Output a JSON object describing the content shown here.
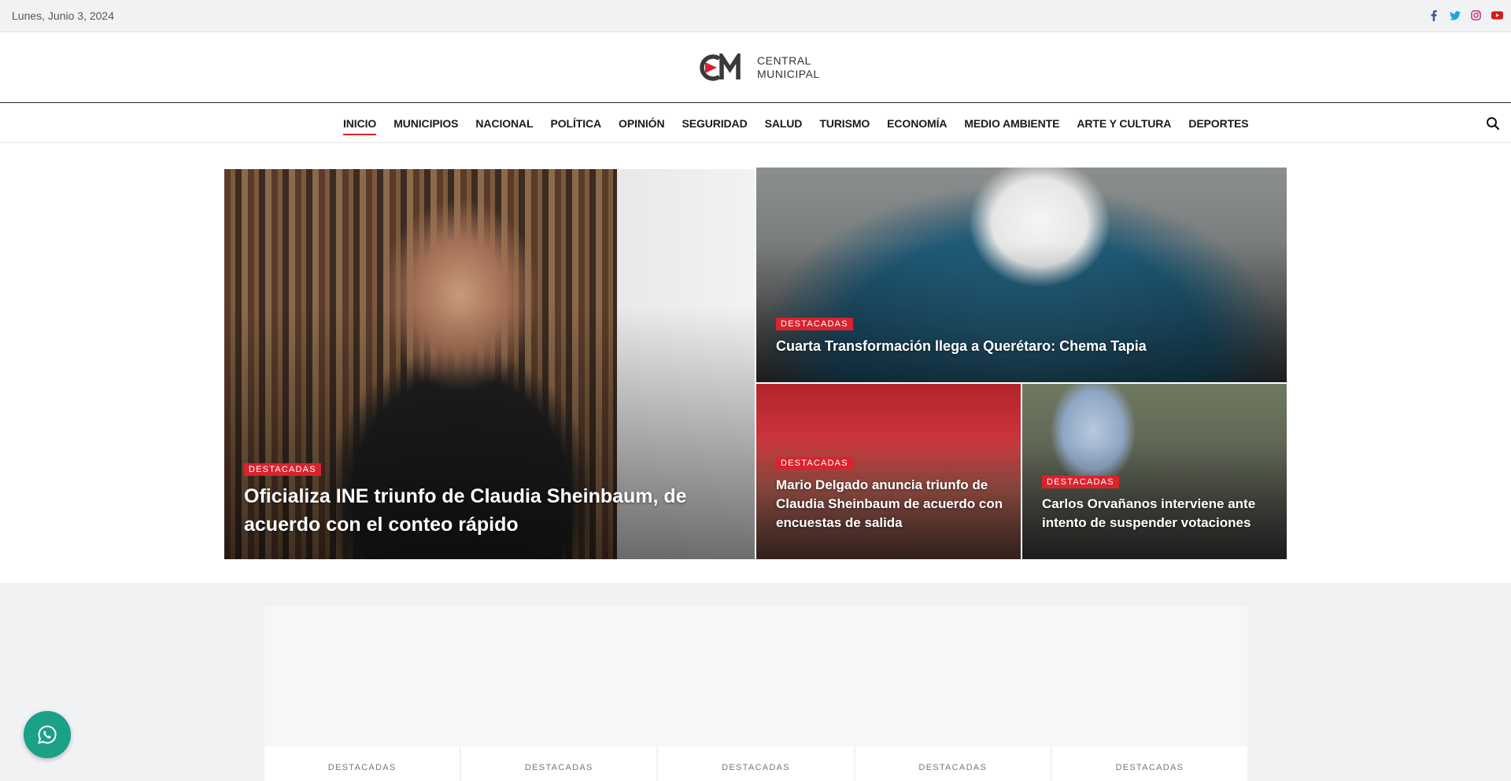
{
  "topbar": {
    "date": "Lunes, Junio 3, 2024",
    "socials": [
      {
        "icon": "facebook-icon",
        "color": "#3b5998"
      },
      {
        "icon": "twitter-icon",
        "color": "#1da1f2"
      },
      {
        "icon": "instagram-icon",
        "color": "#c13584"
      },
      {
        "icon": "youtube-icon",
        "color": "#d61a1a"
      }
    ]
  },
  "logo": {
    "line1": "CENTRAL",
    "line2": "MUNICIPAL"
  },
  "nav": {
    "items": [
      {
        "label": "INICIO",
        "active": true
      },
      {
        "label": "MUNICIPIOS"
      },
      {
        "label": "NACIONAL"
      },
      {
        "label": "POLÍTICA"
      },
      {
        "label": "OPINIÓN"
      },
      {
        "label": "SEGURIDAD"
      },
      {
        "label": "SALUD"
      },
      {
        "label": "TURISMO"
      },
      {
        "label": "ECONOMÍA"
      },
      {
        "label": "MEDIO AMBIENTE"
      },
      {
        "label": "ARTE Y CULTURA"
      },
      {
        "label": "DEPORTES"
      }
    ]
  },
  "hero": {
    "main": {
      "category": "DESTACADAS",
      "title": "Oficializa INE triunfo de Claudia Sheinbaum, de acuerdo con el conteo rápido"
    },
    "top": {
      "category": "DESTACADAS",
      "title": "Cuarta Transformación llega a Querétaro: Chema Tapia"
    },
    "bottom_left": {
      "category": "DESTACADAS",
      "title": "Mario Delgado anuncia triunfo de Claudia Sheinbaum de acuerdo con encuestas de salida"
    },
    "bottom_right": {
      "category": "DESTACADAS",
      "title": "Carlos Orvañanos interviene ante intento de suspender votaciones"
    }
  },
  "lower": {
    "tiles": [
      "DESTACADAS",
      "DESTACADAS",
      "DESTACADAS",
      "DESTACADAS",
      "DESTACADAS"
    ]
  },
  "colors": {
    "accent": "#d9232d",
    "whatsapp": "#1aa187"
  }
}
